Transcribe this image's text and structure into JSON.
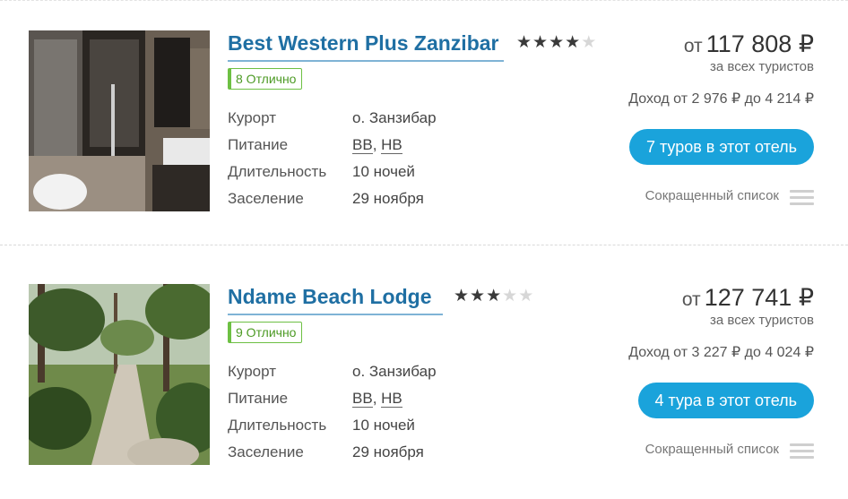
{
  "hotels": [
    {
      "name": "Best Western Plus Zanzibar",
      "stars_filled": 4,
      "stars_total": 5,
      "rating": "8 Отлично",
      "labels": [
        "Курорт",
        "Питание",
        "Длительность",
        "Заселение"
      ],
      "resort": "о. Занзибар",
      "meals": [
        "BB",
        "HB"
      ],
      "duration": "10 ночей",
      "checkin": "29 ноября",
      "price_prefix": "от",
      "price": "117 808",
      "currency": "₽",
      "price_note": "за всех туристов",
      "income_prefix": "Доход от",
      "income_from": "2 976",
      "income_mid": "до",
      "income_to": "4 214",
      "tours_button": "7 туров в этот отель",
      "short_list": "Сокращенный список"
    },
    {
      "name": "Ndame Beach Lodge",
      "stars_filled": 3,
      "stars_total": 5,
      "rating": "9 Отлично",
      "labels": [
        "Курорт",
        "Питание",
        "Длительность",
        "Заселение"
      ],
      "resort": "о. Занзибар",
      "meals": [
        "BB",
        "HB"
      ],
      "duration": "10 ночей",
      "checkin": "29 ноября",
      "price_prefix": "от",
      "price": "127 741",
      "currency": "₽",
      "price_note": "за всех туристов",
      "income_prefix": "Доход от",
      "income_from": "3 227",
      "income_mid": "до",
      "income_to": "4 024",
      "tours_button": "4 тура в этот отель",
      "short_list": "Сокращенный список"
    }
  ],
  "colors": {
    "link": "#1f6fa3",
    "rating_green": "#6dc043",
    "button_blue": "#1aa3db"
  },
  "icons": [
    "star-icon",
    "list-icon"
  ]
}
